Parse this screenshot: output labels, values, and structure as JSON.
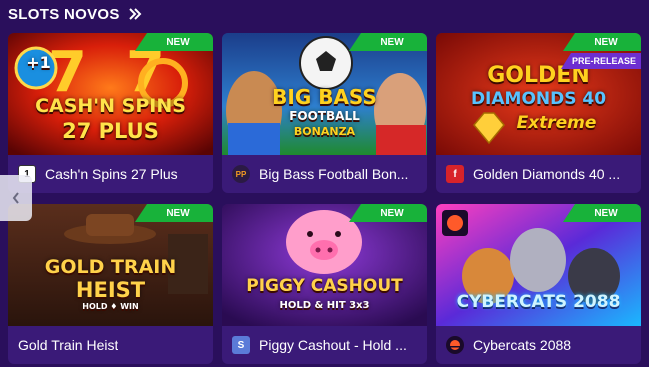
{
  "section": {
    "title": "SLOTS NOVOS"
  },
  "badges": {
    "new": "NEW",
    "pre_release": "PRE-RELEASE"
  },
  "games": [
    {
      "name": "Cash'n Spins 27 Plus",
      "art_title_1": "CASH'N SPINS",
      "art_title_2": "27 PLUS",
      "art_tag": "+1",
      "provider_glyph": "1"
    },
    {
      "name": "Big Bass Football Bon...",
      "art_title_1": "BIG BASS",
      "art_title_2": "FOOTBALL",
      "art_title_3": "BONANZA",
      "provider_glyph": "PP"
    },
    {
      "name": "Golden Diamonds 40 ...",
      "art_title_1": "GOLDEN",
      "art_title_2": "DIAMONDS 40",
      "art_title_3": "Extreme",
      "provider_glyph": "f"
    },
    {
      "name": "Gold Train Heist",
      "art_title_1": "GOLD TRAIN",
      "art_title_2": "HEIST",
      "art_title_3": "HOLD ♦ WIN",
      "provider_glyph": ""
    },
    {
      "name": "Piggy Cashout - Hold ...",
      "art_title_1": "PIGGY CASHOUT",
      "art_title_2": "HOLD & HIT 3x3",
      "provider_glyph": "S"
    },
    {
      "name": "Cybercats 2088",
      "art_title_1": "CYBERCATS 2088",
      "provider_glyph": ""
    }
  ],
  "colors": {
    "background": "#2a0f5c",
    "card": "#3a1a78",
    "new_badge": "#18b23a",
    "pre_release_badge": "#6d2fd1"
  }
}
